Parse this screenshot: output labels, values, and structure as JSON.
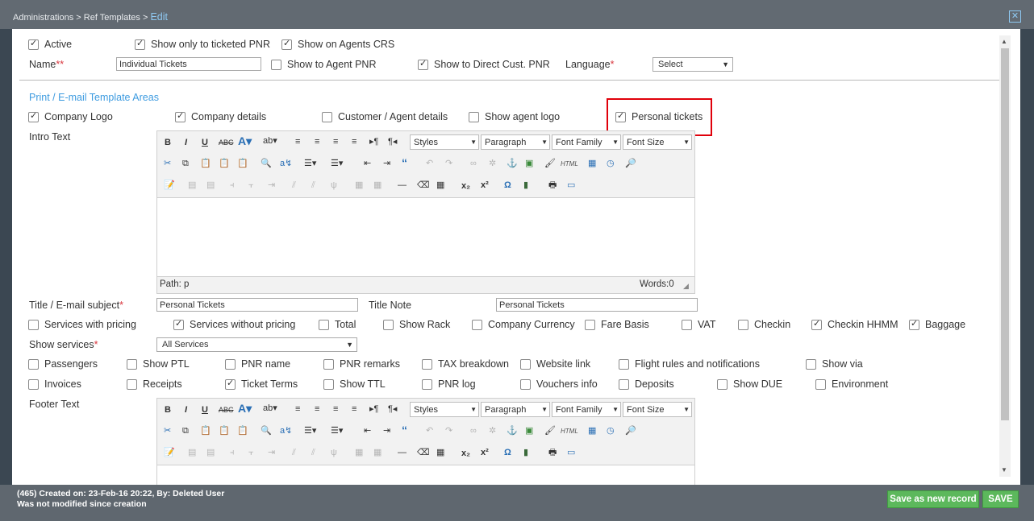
{
  "breadcrumb": {
    "part1": "Administrations",
    "sep": ">",
    "part2": "Ref Templates",
    "current": "Edit"
  },
  "top": {
    "active": {
      "label": "Active",
      "checked": true
    },
    "show_only_ticketed": {
      "label": "Show only to ticketed PNR",
      "checked": true
    },
    "show_on_agents_crs": {
      "label": "Show on Agents CRS",
      "checked": true
    },
    "name_label": "Name",
    "name_req": "**",
    "name_value": "Individual Tickets",
    "show_agent_pnr": {
      "label": "Show to Agent PNR",
      "checked": false
    },
    "show_direct_cust": {
      "label": "Show to Direct Cust. PNR",
      "checked": true
    },
    "language_label": "Language",
    "language_req": "*",
    "language_value": "Select"
  },
  "areas": {
    "title": "Print / E-mail Template Areas",
    "company_logo": {
      "label": "Company Logo",
      "checked": true
    },
    "company_details": {
      "label": "Company details",
      "checked": true
    },
    "customer_agent": {
      "label": "Customer / Agent details",
      "checked": false
    },
    "show_agent_logo": {
      "label": "Show agent logo",
      "checked": false
    },
    "personal_tickets": {
      "label": "Personal tickets",
      "checked": true
    }
  },
  "intro_label": "Intro Text",
  "editor": {
    "styles": "Styles",
    "paragraph": "Paragraph",
    "font_family": "Font Family",
    "font_size": "Font Size",
    "path": "Path: p",
    "words": "Words:0"
  },
  "title_row": {
    "label": "Title / E-mail subject",
    "req": "*",
    "value": "Personal Tickets",
    "note_label": "Title Note",
    "note_value": "Personal Tickets"
  },
  "opts1": [
    {
      "label": "Services with pricing",
      "checked": false
    },
    {
      "label": "Services without pricing",
      "checked": true
    },
    {
      "label": "Total",
      "checked": false
    },
    {
      "label": "Show Rack",
      "checked": false
    },
    {
      "label": "Company Currency",
      "checked": false
    },
    {
      "label": "Fare Basis",
      "checked": false
    },
    {
      "label": "VAT",
      "checked": false
    },
    {
      "label": "Checkin",
      "checked": false
    },
    {
      "label": "Checkin HHMM",
      "checked": true
    },
    {
      "label": "Baggage",
      "checked": true
    }
  ],
  "show_services": {
    "label": "Show services",
    "req": "*",
    "value": "All Services"
  },
  "opts2": [
    {
      "label": "Passengers",
      "checked": false
    },
    {
      "label": "Show PTL",
      "checked": false
    },
    {
      "label": "PNR name",
      "checked": false
    },
    {
      "label": "PNR remarks",
      "checked": false
    },
    {
      "label": "TAX breakdown",
      "checked": false
    },
    {
      "label": "Website link",
      "checked": false
    },
    {
      "label": "Flight rules and notifications",
      "checked": false
    },
    {
      "label": "Show via",
      "checked": false
    }
  ],
  "opts3": [
    {
      "label": "Invoices",
      "checked": false
    },
    {
      "label": "Receipts",
      "checked": false
    },
    {
      "label": "Ticket Terms",
      "checked": true
    },
    {
      "label": "Show TTL",
      "checked": false
    },
    {
      "label": "PNR log",
      "checked": false
    },
    {
      "label": "Vouchers info",
      "checked": false
    },
    {
      "label": "Deposits",
      "checked": false
    },
    {
      "label": "Show DUE",
      "checked": false
    },
    {
      "label": "Environment",
      "checked": false
    }
  ],
  "footer_label": "Footer Text",
  "status": {
    "line1": "(465) Created on: 23-Feb-16 20:22, By: Deleted User",
    "line2": "Was not modified since creation"
  },
  "buttons": {
    "save_new": "Save as new record",
    "save": "SAVE"
  }
}
